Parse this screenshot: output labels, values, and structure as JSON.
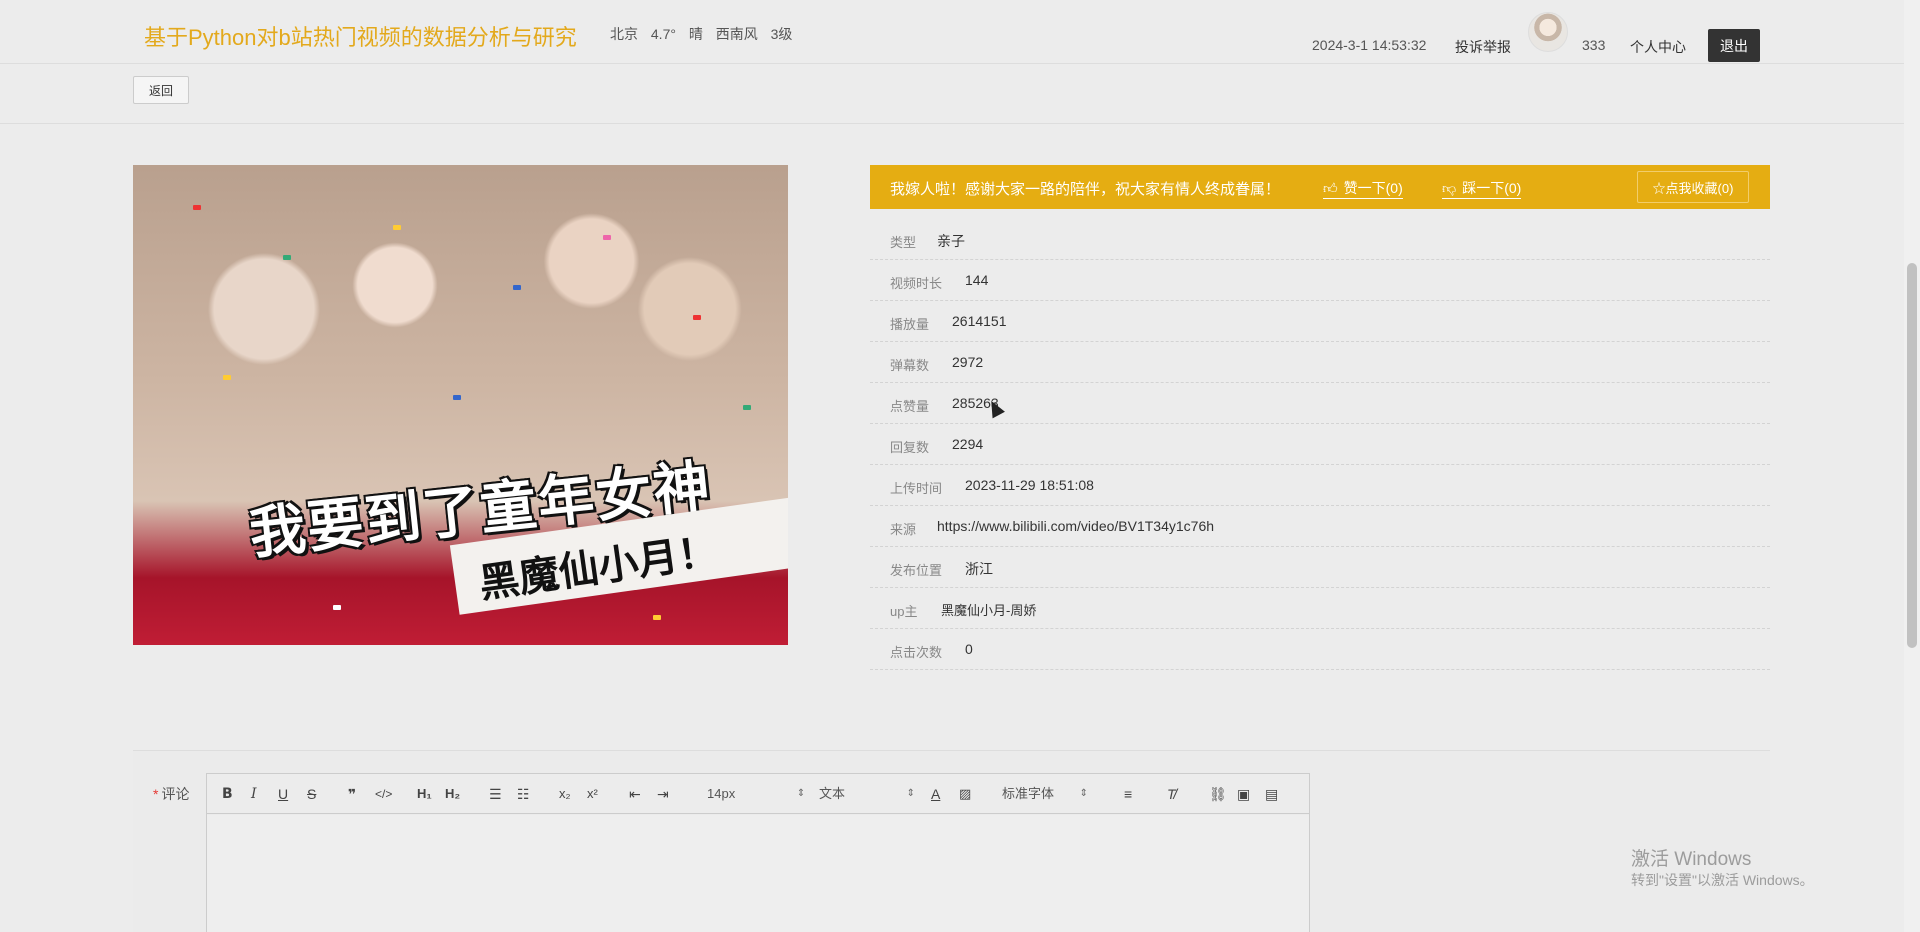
{
  "header": {
    "site_title": "基于Python对b站热门视频的数据分析与研究",
    "weather": {
      "city": "北京",
      "temp": "4.7°",
      "condition": "晴",
      "wind": "西南风",
      "level": "3级"
    },
    "datetime": "2024-3-1 14:53:32",
    "report": "投诉举报",
    "username": "333",
    "user_center": "个人中心",
    "logout": "退出"
  },
  "back_label": "返回",
  "cover": {
    "line1": "我要到了童年女神",
    "line2": "黑魔仙小月！"
  },
  "video": {
    "title": "我嫁人啦！感谢大家一路的陪伴，祝大家有情人终成眷属！",
    "like_label": "赞一下(0)",
    "dislike_label": "踩一下(0)",
    "fav_label": "☆点我收藏(0)",
    "fields": [
      {
        "key": "类型",
        "value": "亲子"
      },
      {
        "key": "视频时长",
        "value": "144"
      },
      {
        "key": "播放量",
        "value": "2614151"
      },
      {
        "key": "弹幕数",
        "value": "2972"
      },
      {
        "key": "点赞量",
        "value": "285263"
      },
      {
        "key": "回复数",
        "value": "2294"
      },
      {
        "key": "上传时间",
        "value": "2023-11-29 18:51:08"
      },
      {
        "key": "来源",
        "value": "https://www.bilibili.com/video/BV1T34y1c76h"
      },
      {
        "key": "发布位置",
        "value": "浙江"
      },
      {
        "key": "up主",
        "value": "黑魔仙小月-周娇"
      },
      {
        "key": "点击次数",
        "value": "0"
      }
    ]
  },
  "comment": {
    "required_mark": "*",
    "label": "评论",
    "font_size": "14px",
    "block_type": "文本",
    "font_family": "标准字体"
  },
  "watermark": {
    "line1": "激活 Windows",
    "line2": "转到\"设置\"以激活 Windows。"
  },
  "colors": {
    "accent": "#e5ad12",
    "title": "#e3a91c",
    "logout_bg": "#333333"
  }
}
